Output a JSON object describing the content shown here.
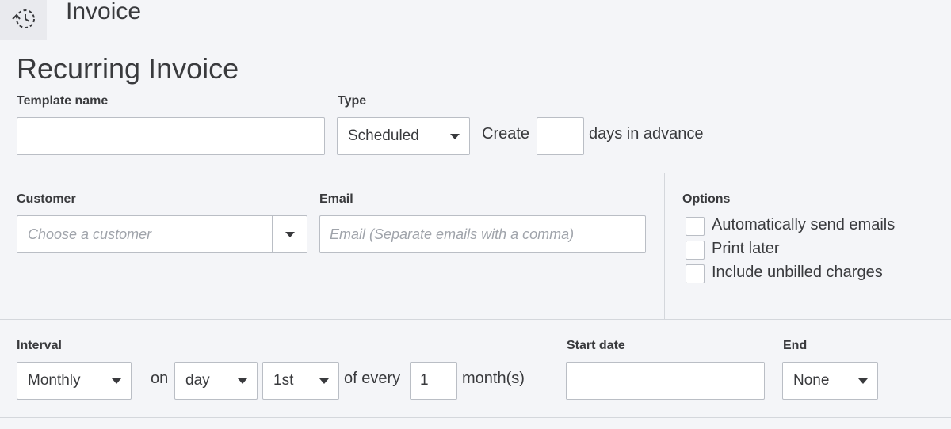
{
  "header": {
    "icon": "recurring-clock-icon",
    "title": "Invoice"
  },
  "page_title": "Recurring Invoice",
  "template": {
    "name_label": "Template name",
    "name_value": "",
    "type_label": "Type",
    "type_value": "Scheduled",
    "create_label": "Create",
    "days_value": "",
    "days_suffix": "days in advance"
  },
  "customer": {
    "label": "Customer",
    "placeholder": "Choose a customer",
    "email_label": "Email",
    "email_placeholder": "Email (Separate emails with a comma)"
  },
  "options": {
    "label": "Options",
    "items": [
      {
        "label": "Automatically send emails",
        "checked": false
      },
      {
        "label": "Print later",
        "checked": false
      },
      {
        "label": "Include unbilled charges",
        "checked": false
      }
    ]
  },
  "interval": {
    "label": "Interval",
    "frequency": "Monthly",
    "on_label": "on",
    "day_type": "day",
    "day_value": "1st",
    "of_every_label": "of every",
    "every_value": "1",
    "unit_label": "month(s)"
  },
  "schedule": {
    "start_date_label": "Start date",
    "start_date_value": "",
    "end_label": "End",
    "end_value": "None"
  }
}
